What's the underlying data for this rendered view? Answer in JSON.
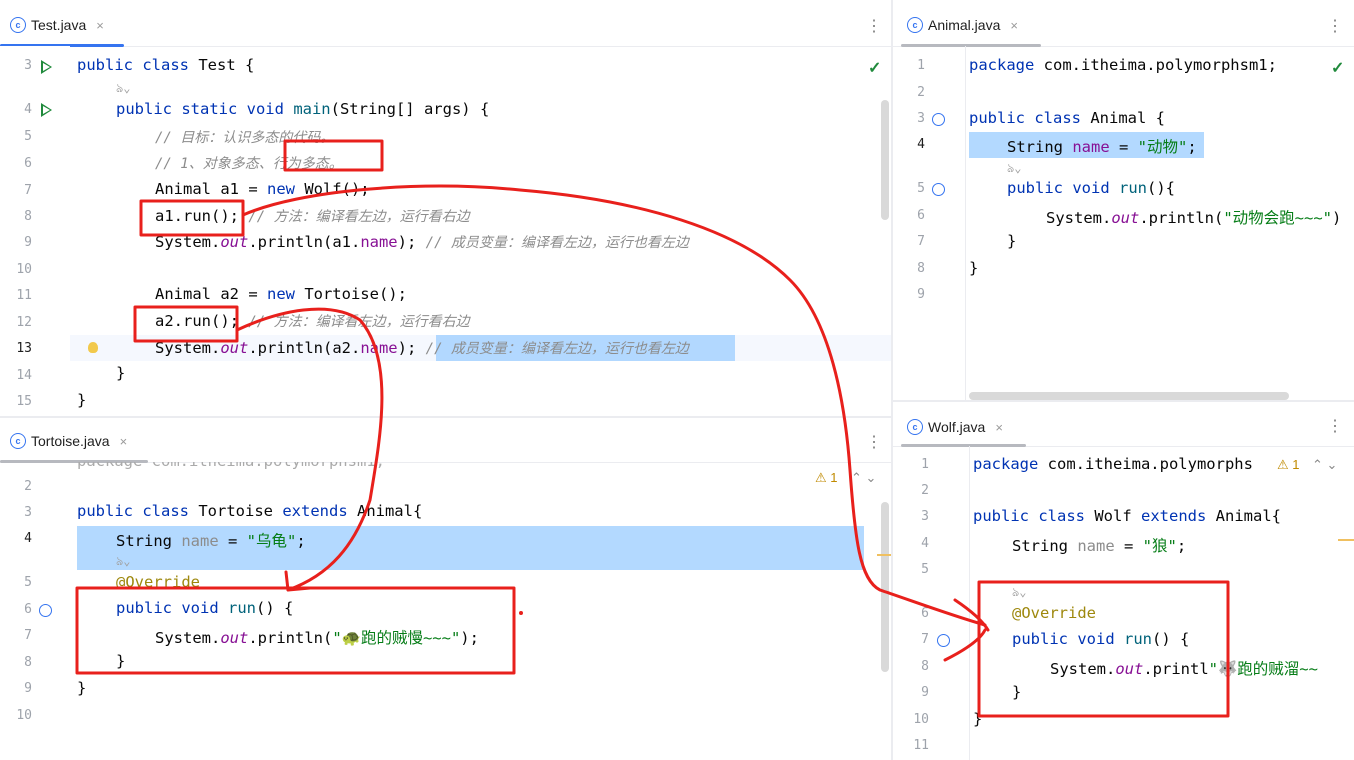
{
  "test_pane": {
    "tab": "Test.java",
    "close": "×",
    "menu": "⋮",
    "check": "✓",
    "line_numbers": [
      "3",
      "4",
      "5",
      "6",
      "7",
      "8",
      "9",
      "10",
      "11",
      "12",
      "13",
      "14",
      "15"
    ],
    "lines": {
      "l3": {
        "kw": "public class ",
        "text": "Test {"
      },
      "hint": "ঌ⌄",
      "l4": {
        "kw": "public static void ",
        "method": "main",
        "text": "(String[] args) {"
      },
      "l5": "// 目标：认识多态的代码。",
      "l6": "// 1、对象多态、行为多态。",
      "l7": {
        "a": "Animal a1 = ",
        "kw": "new ",
        "b": "Wolf();"
      },
      "l8": {
        "a": "a1.run(); ",
        "cmt": "// 方法：编译看左边，运行看右边"
      },
      "l9": {
        "a": "System.",
        "ital": "out",
        "b": ".println(a1.",
        "fld": "name",
        "c": "); ",
        "cmt": "// 成员变量：编译看左边，运行也看左边"
      },
      "l11": {
        "a": "Animal a2 = ",
        "kw": "new ",
        "b": "Tortoise();"
      },
      "l12": {
        "a": "a2.run(); ",
        "cmt": "// 方法：编译看左边，运行看右边"
      },
      "l13": {
        "a": "System.",
        "ital": "out",
        "b": ".println(a2.",
        "fld": "name",
        "c": "); ",
        "cmt": "// 成员变量：编译看左边，运行也看左边"
      },
      "l14": "}",
      "l15": "}"
    }
  },
  "animal_pane": {
    "tab": "Animal.java",
    "close": "×",
    "menu": "⋮",
    "check": "✓",
    "line_numbers": [
      "1",
      "2",
      "3",
      "4",
      "5",
      "6",
      "7",
      "8",
      "9"
    ],
    "l1": {
      "kw": "package ",
      "text": "com.itheima.polymorphsm1;"
    },
    "l3": {
      "kw": "public class ",
      "text": "Animal {"
    },
    "l4": {
      "a": "String ",
      "fld": "name",
      "b": " = ",
      "str": "\"动物\"",
      "c": ";"
    },
    "hint": "ঌ⌄",
    "l5": {
      "kw": "public void ",
      "method": "run",
      "text": "(){"
    },
    "l6": {
      "a": "System.",
      "ital": "out",
      "b": ".println(",
      "str": "\"动物会跑~~~\"",
      "c": ")"
    },
    "l7": "}",
    "l8": "}"
  },
  "tortoise_pane": {
    "tab": "Tortoise.java",
    "close": "×",
    "menu": "⋮",
    "warning": "⚠ 1",
    "nav": "⌃  ⌄",
    "cut_line": "package com.itheima.polymorphsm1;",
    "line_numbers": [
      "2",
      "3",
      "4",
      "5",
      "6",
      "7",
      "8",
      "9",
      "10"
    ],
    "l3": {
      "kw": "public class ",
      "text": "Tortoise ",
      "kw2": "extends ",
      "text2": "Animal{"
    },
    "l4": {
      "a": "String ",
      "dim": "name",
      "b": " = ",
      "str": "\"乌龟\"",
      "c": ";"
    },
    "hint": "ঌ⌄",
    "l5": "@Override",
    "l6": {
      "kw": "public void ",
      "method": "run",
      "text": "() {"
    },
    "l7": {
      "a": "System.",
      "ital": "out",
      "b": ".println(",
      "str": "\"🐢跑的贼慢~~~\"",
      "c": ");"
    },
    "l8": "}",
    "l9": "}"
  },
  "wolf_pane": {
    "tab": "Wolf.java",
    "close": "×",
    "menu": "⋮",
    "warning": "⚠ 1",
    "nav": "⌃  ⌄",
    "line_numbers": [
      "1",
      "2",
      "3",
      "4",
      "5",
      "6",
      "7",
      "8",
      "9",
      "10",
      "11"
    ],
    "l1": {
      "kw": "package ",
      "text": "com.itheima.polymorphs"
    },
    "l3": {
      "kw": "public class ",
      "text": "Wolf ",
      "kw2": "extends ",
      "text2": "Animal{"
    },
    "l4": {
      "a": "String ",
      "dim": "name",
      "b": " = ",
      "str": "\"狼\"",
      "c": ";"
    },
    "hint": "ঌ⌄",
    "l6": "@Override",
    "l7": {
      "kw": "public void ",
      "method": "run",
      "text": "() {"
    },
    "l8": {
      "a": "System.",
      "ital": "out",
      "b": ".printl",
      "str": "\"🐺跑的贼溜~~",
      "c": ""
    },
    "l9": "}",
    "l10": "}"
  },
  "colors": {
    "annotation_red": "#e8201c",
    "selection": "#a6d2ff",
    "keyword": "#0033b3",
    "string": "#067d17"
  }
}
